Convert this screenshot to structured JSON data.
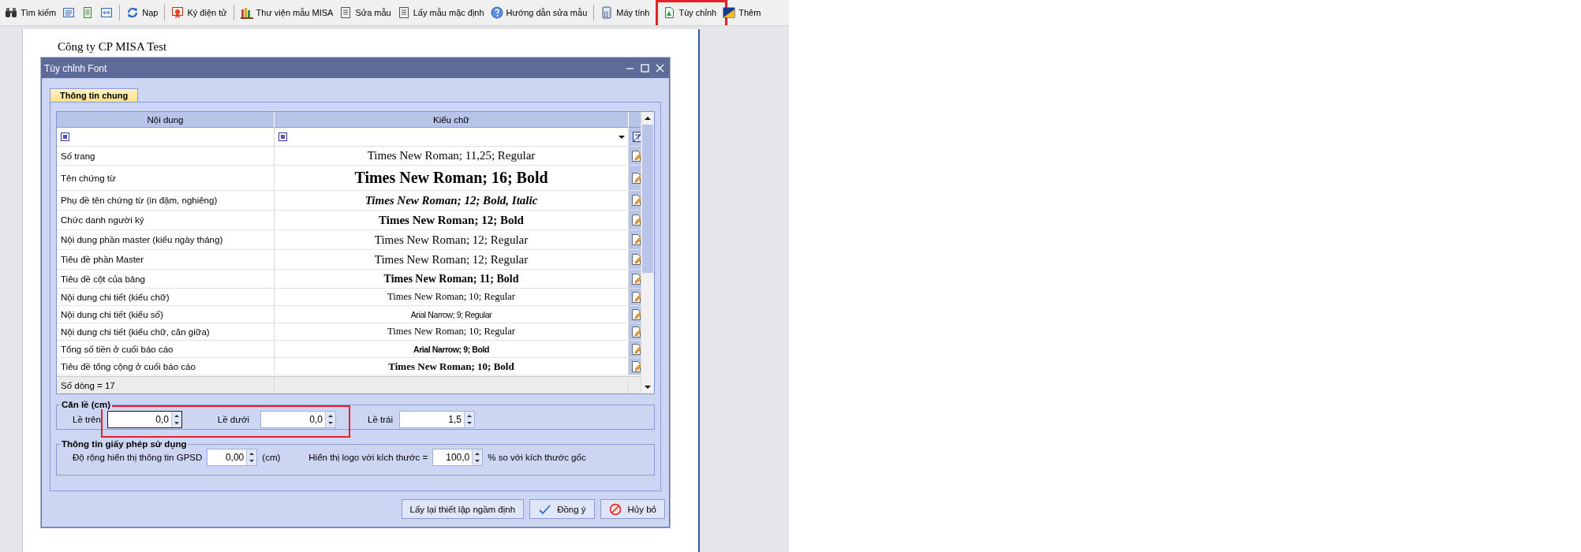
{
  "toolbar": {
    "items": [
      {
        "kind": "labeled",
        "label": "Tìm kiếm",
        "highlighted": false
      },
      {
        "kind": "icon",
        "highlighted": false
      },
      {
        "kind": "icon",
        "highlighted": false
      },
      {
        "kind": "icon",
        "highlighted": false
      },
      {
        "kind": "labeled",
        "label": "Nạp",
        "highlighted": false
      },
      {
        "kind": "labeled",
        "label": "Ký điện tử",
        "highlighted": false
      },
      {
        "kind": "labeled",
        "label": "Thư viện mẫu MISA",
        "highlighted": false
      },
      {
        "kind": "labeled",
        "label": "Sửa mẫu",
        "highlighted": false
      },
      {
        "kind": "labeled",
        "label": "Lấy mẫu mặc định",
        "highlighted": false
      },
      {
        "kind": "labeled",
        "label": "Hướng dẫn sửa mẫu",
        "highlighted": false
      },
      {
        "kind": "labeled",
        "label": "Máy tính",
        "highlighted": false
      },
      {
        "kind": "labeled",
        "label": "Tùy chỉnh",
        "highlighted": true
      },
      {
        "kind": "labeled",
        "label": "Thêm",
        "highlighted": false
      }
    ]
  },
  "document": {
    "company": "Công ty CP MISA Test"
  },
  "dialog": {
    "title": "Tùy chỉnh Font",
    "tabs": [
      {
        "label": "Thông tin chung",
        "selected": true
      }
    ],
    "grid": {
      "columns": [
        "Nội dung",
        "Kiểu chữ"
      ],
      "rows": [
        {
          "content": "Số trang",
          "font": "Times New Roman; 11,25; Regular"
        },
        {
          "content": "Tên chứng từ",
          "font": "Times New Roman; 16; Bold"
        },
        {
          "content": "Phụ đề tên chứng từ (in đậm, nghiêng)",
          "font": "Times New Roman; 12; Bold, Italic"
        },
        {
          "content": "Chức danh người ký",
          "font": "Times New Roman; 12; Bold"
        },
        {
          "content": "Nội dung phần master (kiểu ngày tháng)",
          "font": "Times New Roman; 12; Regular"
        },
        {
          "content": "Tiêu đề phần Master",
          "font": "Times New Roman; 12; Regular"
        },
        {
          "content": "Tiêu đề cột của bảng",
          "font": "Times New Roman; 11; Bold"
        },
        {
          "content": "Nội dung chi tiết (kiểu chữ)",
          "font": "Times New Roman; 10; Regular"
        },
        {
          "content": "Nội dung chi tiết (kiểu số)",
          "font": "Arial Narrow; 9; Regular"
        },
        {
          "content": "Nội dung chi tiết (kiểu chữ, căn giữa)",
          "font": "Times New Roman; 10; Regular"
        },
        {
          "content": "Tổng số tiền ở cuối báo cáo",
          "font": "Arial Narrow; 9; Bold"
        },
        {
          "content": "Tiêu đề tổng cộng ở cuối báo cáo",
          "font": "Times New Roman; 10; Bold"
        }
      ],
      "footer": "Số dòng = 17"
    },
    "margins": {
      "title": "Căn lề (cm)",
      "fields": [
        {
          "label": "Lề trên",
          "value": "0,0",
          "focused": true,
          "highlighted": true
        },
        {
          "label": "Lề dưới",
          "value": "0,0",
          "focused": false,
          "highlighted": true
        },
        {
          "label": "Lề trái",
          "value": "1,5",
          "focused": false,
          "highlighted": false
        }
      ]
    },
    "license": {
      "title": "Thông tin giấy phép sử dụng",
      "items": [
        {
          "kind": "text",
          "text": "Độ rộng hiển thị thông tin GPSD"
        },
        {
          "kind": "field",
          "value": "0,00"
        },
        {
          "kind": "text",
          "text": "(cm)"
        },
        {
          "kind": "text",
          "text": "Hiển thị logo với kích thước ="
        },
        {
          "kind": "field",
          "value": "100,0"
        },
        {
          "kind": "text",
          "text": "% so với kích thước gốc"
        }
      ]
    },
    "buttons": [
      "Lấy lại thiết lập ngầm định",
      "Đồng ý",
      "Hủy bỏ"
    ]
  }
}
